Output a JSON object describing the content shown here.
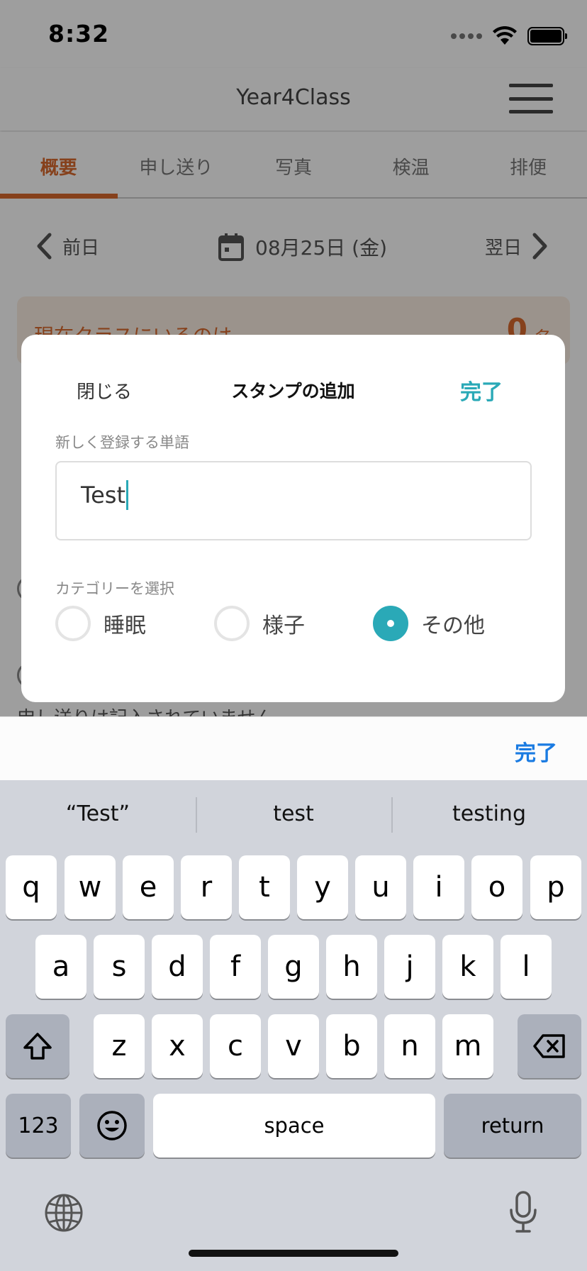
{
  "status_bar": {
    "time": "8:32"
  },
  "header": {
    "title": "Year4Class"
  },
  "tabs": [
    {
      "label": "概要",
      "active": true
    },
    {
      "label": "申し送り",
      "active": false
    },
    {
      "label": "写真",
      "active": false
    },
    {
      "label": "検温",
      "active": false
    },
    {
      "label": "排便",
      "active": false
    }
  ],
  "date_nav": {
    "prev_label": "前日",
    "date": "08月25日 (金)",
    "next_label": "翌日"
  },
  "class_count": {
    "label": "現在クラスにいるのは",
    "count": "0",
    "unit": "名"
  },
  "background_lines": {
    "handover_empty": "申し送りは記入されていません"
  },
  "modal": {
    "close_label": "閉じる",
    "title": "スタンプの追加",
    "done_label": "完了",
    "word_label": "新しく登録する単語",
    "word_value": "Test",
    "category_label": "カテゴリーを選択",
    "categories": [
      {
        "label": "睡眠",
        "selected": false
      },
      {
        "label": "様子",
        "selected": false
      },
      {
        "label": "その他",
        "selected": true
      }
    ]
  },
  "keyboard_toolbar": {
    "done_label": "完了"
  },
  "keyboard": {
    "suggestions": [
      "“Test”",
      "test",
      "testing"
    ],
    "row1": [
      "q",
      "w",
      "e",
      "r",
      "t",
      "y",
      "u",
      "i",
      "o",
      "p"
    ],
    "row2": [
      "a",
      "s",
      "d",
      "f",
      "g",
      "h",
      "j",
      "k",
      "l"
    ],
    "row3": [
      "z",
      "x",
      "c",
      "v",
      "b",
      "n",
      "m"
    ],
    "numbers_label": "123",
    "space_label": "space",
    "return_label": "return"
  },
  "colors": {
    "accent_orange": "#d9692e",
    "accent_teal": "#2aa9b7",
    "ios_blue": "#1a7be2"
  },
  "icons": [
    "wifi-icon",
    "battery-icon",
    "hamburger-menu-icon",
    "chevron-left-icon",
    "calendar-icon",
    "chevron-right-icon",
    "shift-icon",
    "backspace-icon",
    "emoji-icon",
    "globe-icon",
    "microphone-icon"
  ]
}
